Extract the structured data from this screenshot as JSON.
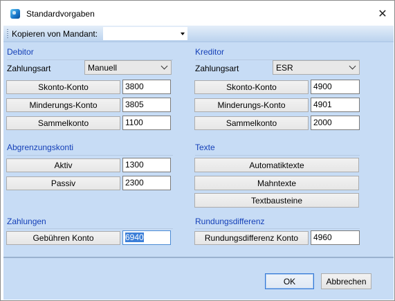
{
  "window": {
    "title": "Standardvorgaben",
    "app_icon": "app-icon",
    "close_icon": "close-icon"
  },
  "toolbar": {
    "label": "Kopieren von Mandant:",
    "combo_value": ""
  },
  "debitor": {
    "title": "Debitor",
    "zahlungsart_label": "Zahlungsart",
    "zahlungsart_value": "Manuell",
    "rows": [
      {
        "button": "Skonto-Konto",
        "value": "3800"
      },
      {
        "button": "Minderungs-Konto",
        "value": "3805"
      },
      {
        "button": "Sammelkonto",
        "value": "1100"
      }
    ]
  },
  "kreditor": {
    "title": "Kreditor",
    "zahlungsart_label": "Zahlungsart",
    "zahlungsart_value": "ESR",
    "rows": [
      {
        "button": "Skonto-Konto",
        "value": "4900"
      },
      {
        "button": "Minderungs-Konto",
        "value": "4901"
      },
      {
        "button": "Sammelkonto",
        "value": "2000"
      }
    ]
  },
  "abgrenzung": {
    "title": "Abgrenzungskonti",
    "rows": [
      {
        "button": "Aktiv",
        "value": "1300"
      },
      {
        "button": "Passiv",
        "value": "2300"
      }
    ]
  },
  "texte": {
    "title": "Texte",
    "buttons": [
      "Automatiktexte",
      "Mahntexte",
      "Textbausteine"
    ]
  },
  "zahlungen": {
    "title": "Zahlungen",
    "button": "Gebühren Konto",
    "value": "6940"
  },
  "rundung": {
    "title": "Rundungsdifferenz",
    "button": "Rundungsdifferenz Konto",
    "value": "4960"
  },
  "footer": {
    "ok": "OK",
    "cancel": "Abbrechen"
  },
  "colors": {
    "panel": "#c7dcf5",
    "group_title": "#1540b8",
    "ok_border": "#3478d6",
    "selection": "#3c7fd8"
  }
}
